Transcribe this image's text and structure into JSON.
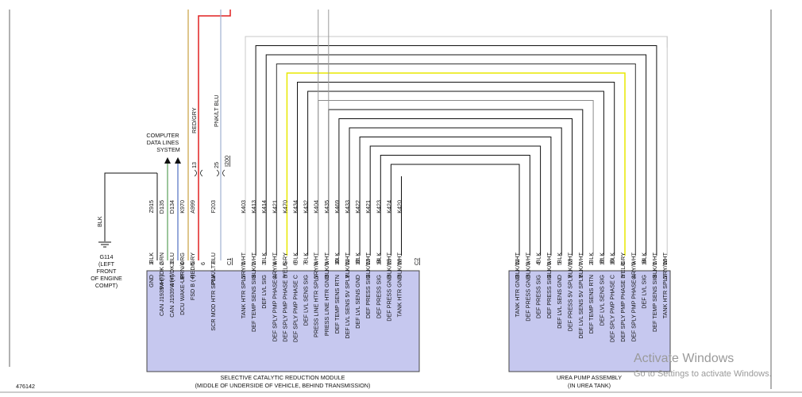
{
  "figure_id": "476142",
  "watermark": {
    "title": "Activate Windows",
    "subtitle": "Go to Settings to activate Windows."
  },
  "module_left": {
    "title": "SELECTIVE CATALYTIC REDUCTION MODULE",
    "subtitle": "(MIDDLE OF UNDERSIDE OF VEHICLE, BEHIND TRANSMISSION)",
    "group1": {
      "connector": "C1",
      "pins": [
        {
          "pin": "1",
          "color": "BLK",
          "circuit": "Z915",
          "func": "GND"
        },
        {
          "pin": "2",
          "color": "WHT/DK GRN",
          "circuit": "D135",
          "func": "CAN J1939 4 (-)"
        },
        {
          "pin": "3",
          "color": "WHT/DK BLU",
          "circuit": "D134",
          "func": "CAN J1939 4 (+)"
        },
        {
          "pin": "4",
          "color": "BRN/ORG",
          "circuit": "K970",
          "func": "DCU WAKE-UP"
        },
        {
          "pin": "5",
          "color": "RED/GRY",
          "circuit": "A999",
          "func": "FSD B (+)"
        },
        {
          "pin": "6",
          "color": "",
          "circuit": "",
          "func": ""
        },
        {
          "pin": "7",
          "color": "PNK/LT BLU",
          "circuit": "F203",
          "func": "SCR MOD HTR SPLY"
        }
      ]
    },
    "group2": {
      "connector": "C2",
      "pins": [
        {
          "pin": "1",
          "color": "GRY/WHT",
          "circuit": "K403",
          "func": "TANK HTR SPLY"
        },
        {
          "pin": "2",
          "color": "BLK/WHT",
          "circuit": "K413",
          "func": "DEF TEMP SENS SIG"
        },
        {
          "pin": "3",
          "color": "BLK",
          "circuit": "K414",
          "func": "DEF LVL SIG"
        },
        {
          "pin": "4",
          "color": "GRY/WHT",
          "circuit": "K421",
          "func": "DEF SPLY PMP PHASE A"
        },
        {
          "pin": "5",
          "color": "YEL/GRY",
          "circuit": "K470",
          "func": "DEF SPLY PMP PHASE B"
        },
        {
          "pin": "6",
          "color": "BLK",
          "circuit": "K434",
          "func": "DEF SPLY PMP PHASE C"
        },
        {
          "pin": "7",
          "color": "BLK",
          "circuit": "K432",
          "func": "DEF LVL SENS SIG"
        },
        {
          "pin": "8",
          "color": "GRY/WHT",
          "circuit": "K404",
          "func": "PRESS LINE HTR SPLY"
        },
        {
          "pin": "9",
          "color": "BLK/WHT",
          "circuit": "K435",
          "func": "PRESS LINE HTR GND"
        },
        {
          "pin": "10",
          "color": "BLK",
          "circuit": "K469",
          "func": "DEF TEMP SENS RTN"
        },
        {
          "pin": "11",
          "color": "BLK/WHT",
          "circuit": "K433",
          "func": "DEF LVL SENS 5V SPLY"
        },
        {
          "pin": "12",
          "color": "BLK",
          "circuit": "K422",
          "func": "DEF LVL SENS GND"
        },
        {
          "pin": "13",
          "color": "BLK/WHT",
          "circuit": "K421",
          "func": "DEF PRESS SIG"
        },
        {
          "pin": "14",
          "color": "BLK",
          "circuit": "K423",
          "func": "DEF PRESS SIG"
        },
        {
          "pin": "15",
          "color": "BLK/WHT",
          "circuit": "K424",
          "func": "DEF PRESS GND"
        },
        {
          "pin": "16",
          "color": "BLK/WHT",
          "circuit": "K420",
          "func": "TANK HTR GND"
        }
      ]
    }
  },
  "module_right": {
    "title": "UREA PUMP ASSEMBLY",
    "subtitle": "(IN UREA TANK)",
    "pins": [
      {
        "pin": "11",
        "color": "BLK/WHT",
        "func": "TANK HTR GND"
      },
      {
        "pin": "3",
        "color": "BLK/WHT",
        "func": "DEF PRESS GND"
      },
      {
        "pin": "4",
        "color": "BLK",
        "func": "DEF PRESS SIG"
      },
      {
        "pin": "6",
        "color": "BLK/WHT",
        "func": "DEF PRESS SIG"
      },
      {
        "pin": "5",
        "color": "BLK",
        "func": "DEF LVL SENS GND"
      },
      {
        "pin": "13",
        "color": "BLK/WHT",
        "func": "DEF PRESS 5V SPLY"
      },
      {
        "pin": "7",
        "color": "BLK/WHT",
        "func": "DEF LVL SENS 5V SPLY"
      },
      {
        "pin": "2",
        "color": "BLK",
        "func": "DEF TEMP SENS RTN"
      },
      {
        "pin": "12",
        "color": "BLK",
        "func": "DEF LVL SENS SIG"
      },
      {
        "pin": "10",
        "color": "BLK",
        "func": "DEF SPLY PMP PHASE C"
      },
      {
        "pin": "8",
        "color": "YEL/GRY",
        "func": "DEF SPLY PMP PHASE B"
      },
      {
        "pin": "9",
        "color": "GRY/WHT",
        "func": "DEF SPLY PMP PHASE A"
      },
      {
        "pin": "14",
        "color": "BLK",
        "func": "DEF LVL SIG"
      },
      {
        "pin": "1",
        "color": "BLK/WHT",
        "func": "DEF TEMP SENS SIG"
      },
      {
        "pin": "16",
        "color": "GRY/WHT",
        "func": "TANK HTR SPLY"
      }
    ]
  },
  "ground": {
    "wire_color": "BLK",
    "id": "G114",
    "loc1": "(LEFT",
    "loc2": "FRONT",
    "loc3": "OF ENGINE",
    "loc4": "COMPT)"
  },
  "data_lines": {
    "l1": "COMPUTER",
    "l2": "DATA LINES",
    "l3": "SYSTEM"
  },
  "upper_wires": {
    "red_gry": "RED/GRY",
    "pnk_lt_blu": "PNK/LT BLU",
    "splice_13": "13",
    "splice_25": "25",
    "ref": "I200"
  },
  "colors": {
    "box_fill": "#c6c8ef",
    "box_stroke": "#444444",
    "yellow": "#e8e800",
    "red": "#e02020",
    "tan": "#c8a040",
    "gray": "#9a9a9a",
    "light_gray": "#c8c8c8"
  }
}
